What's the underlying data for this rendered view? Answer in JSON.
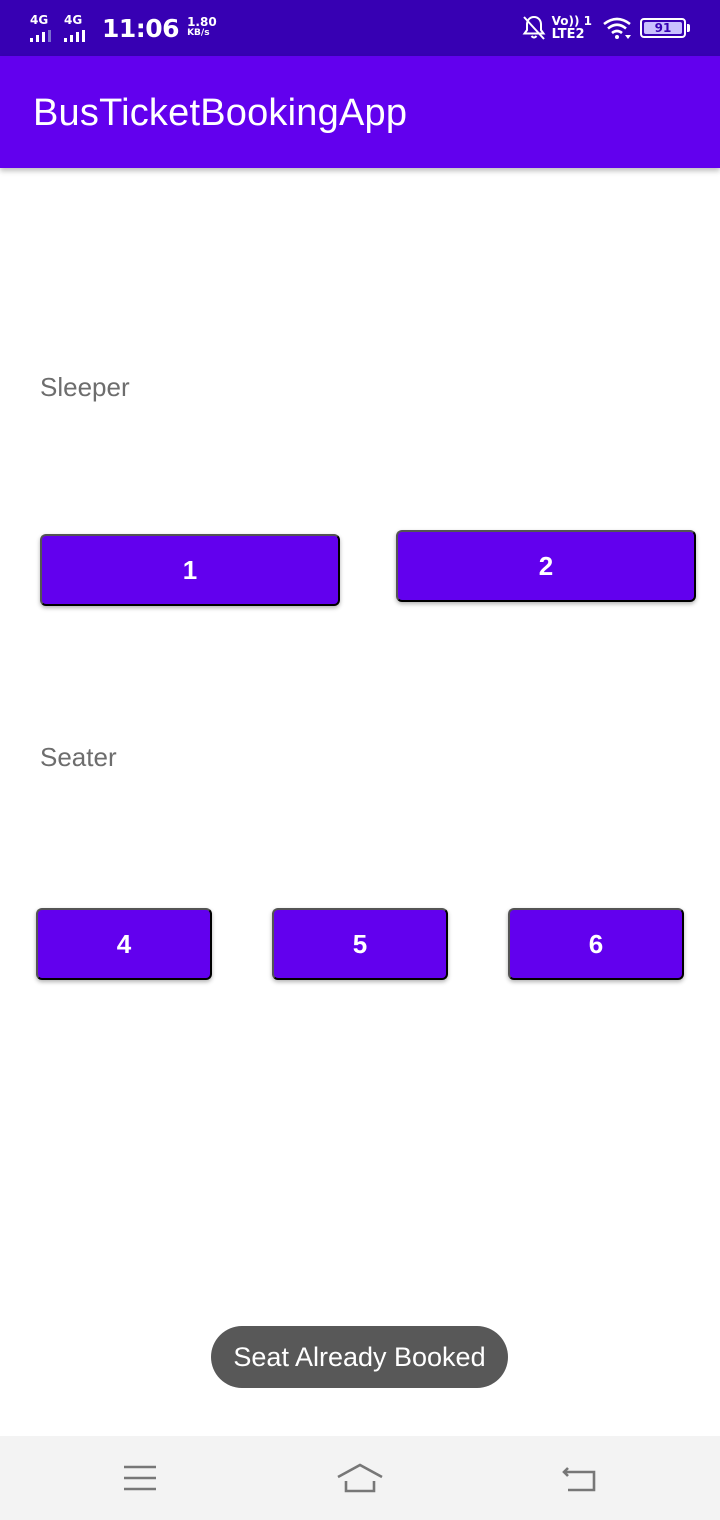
{
  "status_bar": {
    "network1": "4G",
    "network2": "4G",
    "time": "11:06",
    "speed_value": "1.80",
    "speed_unit": "KB/s",
    "volte_top": "Vo)) 1",
    "volte_bottom": "LTE2",
    "battery": "91",
    "icons": [
      "signal-icon",
      "signal-icon",
      "notifications-off-icon",
      "wifi-icon",
      "battery-icon"
    ]
  },
  "app_bar": {
    "title": "BusTicketBookingApp",
    "color": "#6200ee"
  },
  "sleeper": {
    "label": "Sleeper",
    "seats": [
      "1",
      "2"
    ]
  },
  "seater": {
    "label": "Seater",
    "seats": [
      "4",
      "5",
      "6"
    ]
  },
  "toast": {
    "message": "Seat Already Booked"
  },
  "nav_bar": {
    "icons": [
      "menu-icon",
      "home-icon",
      "back-icon"
    ]
  }
}
